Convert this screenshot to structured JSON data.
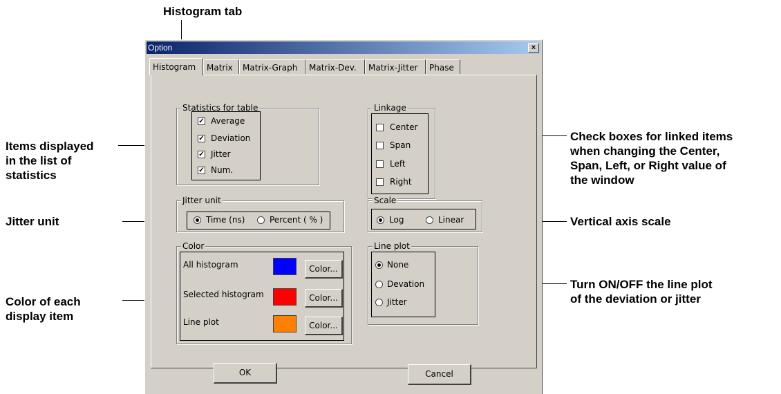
{
  "callouts": {
    "histogram_tab": "Histogram tab",
    "items_displayed": [
      "Items displayed",
      "in the list of",
      "statistics"
    ],
    "jitter_unit": "Jitter unit",
    "color_each": [
      "Color of each",
      "display item"
    ],
    "check_boxes": [
      "Check boxes for linked items",
      "when changing the Center,",
      "Span, Left, or Right value of",
      "the window"
    ],
    "vertical_axis": "Vertical axis scale",
    "line_plot_onoff": [
      "Turn ON/OFF the line plot",
      "of the deviation or jitter"
    ]
  },
  "dialog": {
    "title": "Option",
    "close_label": "×",
    "tabs": [
      "Histogram",
      "Matrix",
      "Matrix-Graph",
      "Matrix-Dev.",
      "Matrix-Jitter",
      "Phase"
    ],
    "active_tab": "Histogram",
    "statistics": {
      "label": "Statistics for table",
      "items": [
        {
          "label": "Average",
          "checked": true
        },
        {
          "label": "Deviation",
          "checked": true
        },
        {
          "label": "Jitter",
          "checked": true
        },
        {
          "label": "Num.",
          "checked": true
        }
      ]
    },
    "linkage": {
      "label": "Linkage",
      "items": [
        {
          "label": "Center",
          "checked": false
        },
        {
          "label": "Span",
          "checked": false
        },
        {
          "label": "Left",
          "checked": false
        },
        {
          "label": "Right",
          "checked": false
        }
      ]
    },
    "jitter_unit": {
      "label": "Jitter unit",
      "options": [
        "Time (ns)",
        "Percent ( % )"
      ],
      "selected": "Time (ns)"
    },
    "scale": {
      "label": "Scale",
      "options": [
        "Log",
        "Linear"
      ],
      "selected": "Log"
    },
    "color": {
      "label": "Color",
      "rows": [
        {
          "label": "All histogram",
          "color": "#0000ff",
          "button": "Color..."
        },
        {
          "label": "Selected histogram",
          "color": "#ff0000",
          "button": "Color..."
        },
        {
          "label": "Line plot",
          "color": "#ff8000",
          "button": "Color..."
        }
      ]
    },
    "line_plot": {
      "label": "Line plot",
      "options": [
        "None",
        "Devation",
        "Jitter"
      ],
      "selected": "None"
    },
    "ok_label": "OK",
    "cancel_label": "Cancel"
  }
}
